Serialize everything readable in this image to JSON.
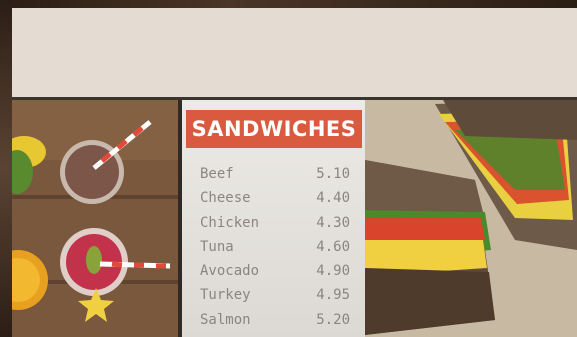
{
  "menu": {
    "title": "SANDWICHES",
    "items": [
      {
        "name": "Beef",
        "price": "5.10"
      },
      {
        "name": "Cheese",
        "price": "4.40"
      },
      {
        "name": "Chicken",
        "price": "4.30"
      },
      {
        "name": "Tuna",
        "price": "4.60"
      },
      {
        "name": "Avocado",
        "price": "4.90"
      },
      {
        "name": "Turkey",
        "price": "4.95"
      },
      {
        "name": "Salmon",
        "price": "5.20"
      }
    ]
  },
  "colors": {
    "header_accent": "#d95a3e",
    "screen_background": "#e4dbd2",
    "item_text": "#8a8580"
  },
  "images": {
    "left_photo": "drinks-on-wooden-table",
    "right_photo": "sandwich-on-paper"
  }
}
